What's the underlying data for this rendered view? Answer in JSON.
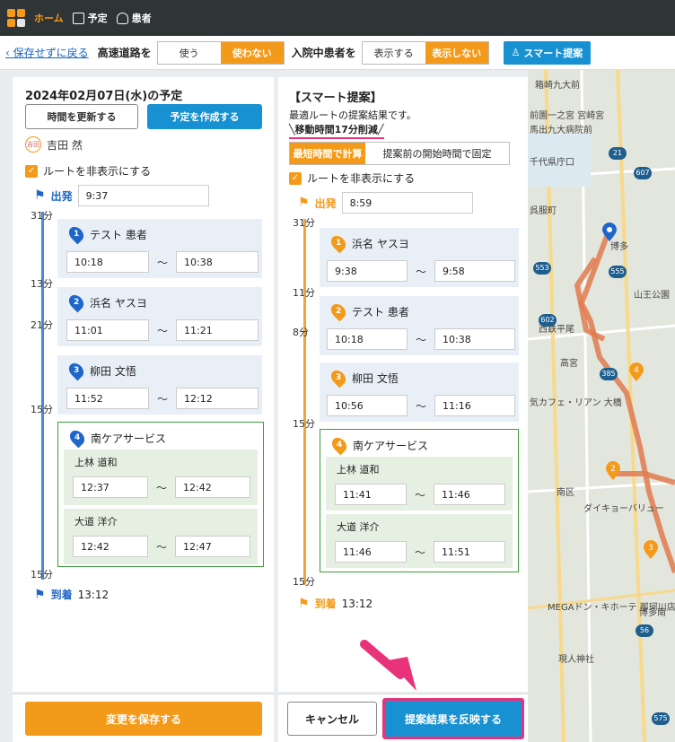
{
  "nav": {
    "home": "ホーム",
    "schedule": "予定",
    "patients": "患者"
  },
  "toolbar": {
    "back": "保存せずに戻る",
    "highway_label": "高速道路を",
    "highway_use": "使う",
    "highway_nouse": "使わない",
    "inpatient_label": "入院中患者を",
    "inpatient_show": "表示する",
    "inpatient_hide": "表示しない",
    "smart_button": "スマート提案"
  },
  "left": {
    "title": "2024年02月07日(水)の予定",
    "update_time_button": "時間を更新する",
    "create_schedule_button": "予定を作成する",
    "staff_tag": "吉田",
    "staff_name": "吉田 然",
    "hide_route": "ルートを非表示にする",
    "depart_label": "出発",
    "depart_time": "9:37",
    "gaps": [
      "31分",
      "13分",
      "21分",
      "15分",
      "15分"
    ],
    "stops": [
      {
        "num": "1",
        "name": "テスト 患者",
        "start": "10:18",
        "end": "10:38"
      },
      {
        "num": "2",
        "name": "浜名 ヤスヨ",
        "start": "11:01",
        "end": "11:21"
      },
      {
        "num": "3",
        "name": "柳田 文悟",
        "start": "11:52",
        "end": "12:12"
      }
    ],
    "facility": {
      "num": "4",
      "name": "南ケアサービス",
      "people": [
        {
          "name": "上林 道和",
          "start": "12:37",
          "end": "12:42"
        },
        {
          "name": "大道 洋介",
          "start": "12:42",
          "end": "12:47"
        }
      ]
    },
    "arrive_label": "到着",
    "arrive_time": "13:12",
    "tilde": "〜",
    "save_button": "変更を保存する"
  },
  "right": {
    "title": "【スマート提案】",
    "subtitle": "最適ルートの提案結果です。",
    "reduction": "╲移動時間17分削減╱",
    "tab_shortest": "最短時間で計算",
    "tab_fixed": "提案前の開始時間で固定",
    "hide_route": "ルートを非表示にする",
    "depart_label": "出発",
    "depart_time": "8:59",
    "gaps": [
      "31分",
      "11分",
      "8分",
      "15分",
      "15分"
    ],
    "stops": [
      {
        "num": "1",
        "name": "浜名 ヤスヨ",
        "start": "9:38",
        "end": "9:58"
      },
      {
        "num": "2",
        "name": "テスト 患者",
        "start": "10:18",
        "end": "10:38"
      },
      {
        "num": "3",
        "name": "柳田 文悟",
        "start": "10:56",
        "end": "11:16"
      }
    ],
    "facility": {
      "num": "4",
      "name": "南ケアサービス",
      "people": [
        {
          "name": "上林 道和",
          "start": "11:41",
          "end": "11:46"
        },
        {
          "name": "大道 洋介",
          "start": "11:46",
          "end": "11:51"
        }
      ]
    },
    "arrive_label": "到着",
    "arrive_time": "13:12",
    "tilde": "〜",
    "cancel_button": "キャンセル",
    "apply_button": "提案結果を反映する"
  },
  "map": {
    "labels": [
      "箱崎九大前",
      "前園一之宮 宮崎宮",
      "馬出九大病院前",
      "千代県庁口",
      "呉服町",
      "博多",
      "山王公園",
      "西鉄平尾",
      "高宮",
      "気カフェ・リアン 大橋",
      "南区",
      "ダイキョーバリュー",
      "MEGAドン・キホーテ 那珂川店",
      "現人神社",
      "博多南"
    ],
    "route_color": "#e07a4f",
    "accent": "#f49a1a"
  }
}
